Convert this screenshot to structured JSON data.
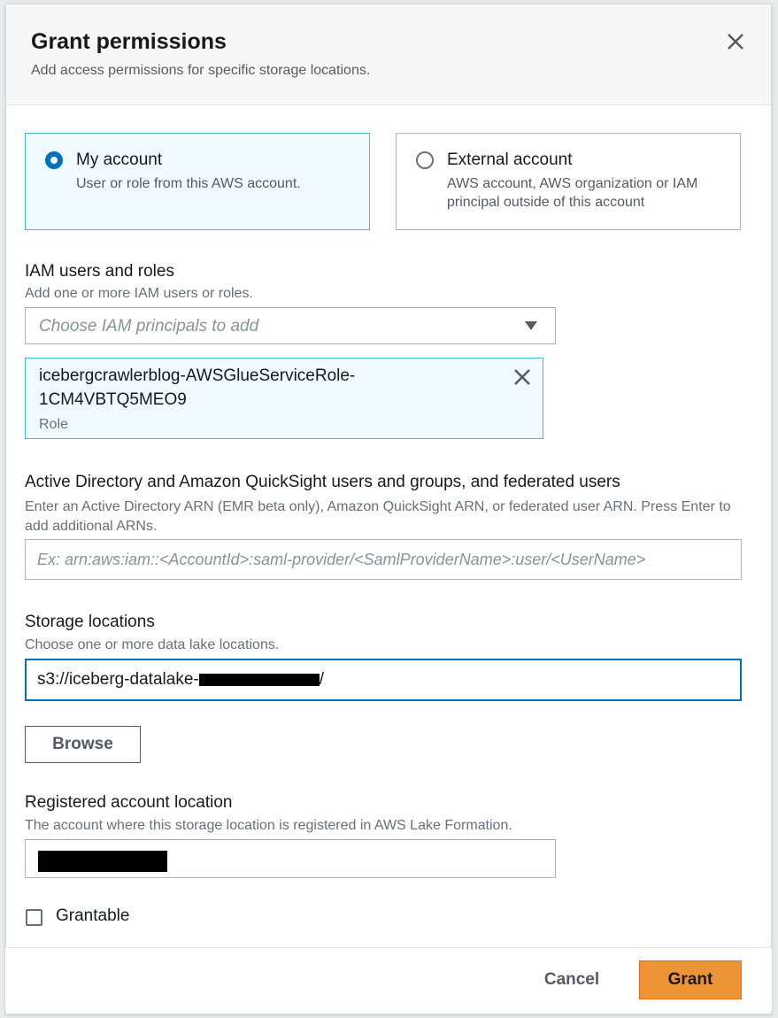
{
  "dialog": {
    "title": "Grant permissions",
    "subtitle": "Add access permissions for specific storage locations."
  },
  "account_options": [
    {
      "label": "My account",
      "description": "User or role from this AWS account.",
      "selected": true
    },
    {
      "label": "External account",
      "description": "AWS account, AWS organization or IAM principal outside of this account",
      "selected": false
    }
  ],
  "iam": {
    "label": "IAM users and roles",
    "description": "Add one or more IAM users or roles.",
    "placeholder": "Choose IAM principals to add",
    "token": {
      "line1": "icebergcrawlerblog-AWSGlueServiceRole-",
      "line2": "1CM4VBTQ5MEO9",
      "type": "Role"
    }
  },
  "active_directory": {
    "label": "Active Directory and Amazon QuickSight users and groups, and federated users",
    "description": "Enter an Active Directory ARN (EMR beta only), Amazon QuickSight ARN, or federated user ARN. Press Enter to add additional ARNs.",
    "placeholder": "Ex: arn:aws:iam::<AccountId>:saml-provider/<SamlProviderName>:user/<UserName>"
  },
  "storage": {
    "label": "Storage locations",
    "description": "Choose one or more data lake locations.",
    "value_prefix": "s3://iceberg-datalake-",
    "value_suffix": "/",
    "browse_label": "Browse"
  },
  "registered": {
    "label": "Registered account location",
    "description": "The account where this storage location is registered in AWS Lake Formation."
  },
  "grantable": {
    "label": "Grantable",
    "checked": false
  },
  "footer": {
    "cancel_label": "Cancel",
    "grant_label": "Grant"
  },
  "colors": {
    "accent": "#0073bb",
    "primary_button": "#ec9335",
    "selected_tile": "#f1faff"
  }
}
